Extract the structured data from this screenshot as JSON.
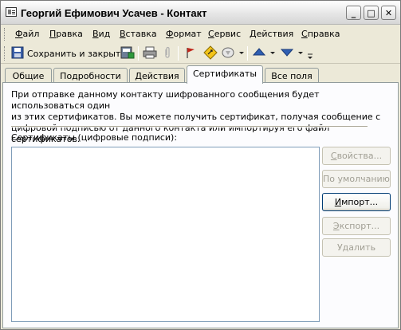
{
  "window": {
    "title": "Георгий Ефимович Усачев - Контакт",
    "controls": {
      "minimize": "_",
      "maximize": "□",
      "close": "✕"
    }
  },
  "menu": {
    "items": [
      {
        "label": "Файл",
        "underline": "Ф",
        "rest": "айл"
      },
      {
        "label": "Правка",
        "underline": "П",
        "rest": "равка"
      },
      {
        "label": "Вид",
        "underline": "В",
        "rest": "ид"
      },
      {
        "label": "Вставка",
        "underline": "В",
        "rest": "ставка"
      },
      {
        "label": "Формат",
        "underline": "Ф",
        "rest": "ормат"
      },
      {
        "label": "Сервис",
        "underline": "С",
        "rest": "ервис"
      },
      {
        "label": "Действия",
        "underline": "Д",
        "rest": "ействия"
      },
      {
        "label": "Справка",
        "underline": "С",
        "rest": "правка"
      }
    ]
  },
  "toolbar": {
    "save_close_label": "Сохранить и закрыть",
    "icons": [
      "save-icon",
      "save-as-icon",
      "print-icon",
      "attach-icon",
      "flag-icon",
      "categorize-icon",
      "map-icon",
      "up-arrow-icon",
      "down-arrow-icon"
    ]
  },
  "tabs": [
    {
      "label": "Общие",
      "active": false
    },
    {
      "label": "Подробности",
      "active": false
    },
    {
      "label": "Действия",
      "active": false
    },
    {
      "label": "Сертификаты",
      "active": true
    },
    {
      "label": "Все поля",
      "active": false
    }
  ],
  "certificates": {
    "info_line1": "При отправке данному контакту шифрованного сообщения будет использоваться один",
    "info_line2": "из этих сертификатов.  Вы можете получить сертификат, получая сообщение с",
    "info_line3": "цифровой подписью от данного контакта или импортируя его файл сертификатов.",
    "list_label": "Сертификаты (цифровые подписи):",
    "items": [],
    "buttons": {
      "properties": "Свойства...",
      "default": "По умолчанию",
      "import": "Импорт...",
      "export": "Экспорт...",
      "delete": "Удалить"
    }
  },
  "colors": {
    "window_bg": "#ece9d8",
    "panel_bg": "#fcfcfe",
    "flag_red": "#c0281c",
    "arrow_blue": "#2f5fb3"
  }
}
